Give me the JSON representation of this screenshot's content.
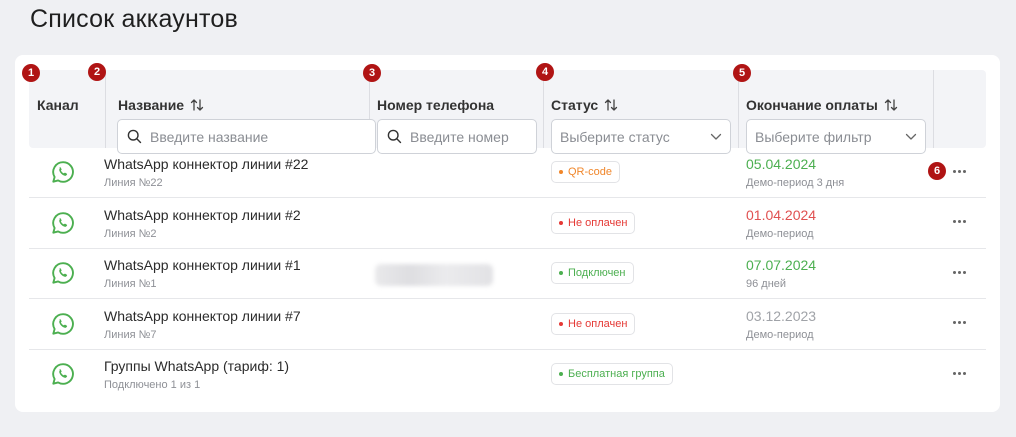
{
  "page_title": "Список аккаунтов",
  "columns": {
    "channel": "Канал",
    "name": "Название",
    "phone": "Номер телефона",
    "status": "Статус",
    "payment_end": "Окончание оплаты"
  },
  "filters": {
    "name_placeholder": "Введите название",
    "phone_placeholder": "Введите номер",
    "status_placeholder": "Выберите статус",
    "payment_placeholder": "Выберите фильтр"
  },
  "markers": [
    "1",
    "2",
    "3",
    "4",
    "5",
    "6"
  ],
  "colors": {
    "whatsapp": "#4caf50",
    "status_orange": "#f0862a",
    "status_red": "#e53935",
    "status_green": "#4caf50",
    "date_green": "#4caf50",
    "date_red": "#e05050",
    "date_grey": "#a0a3a8",
    "marker": "#b01414"
  },
  "rows": [
    {
      "name": "WhatsApp коннектор линии #22",
      "sub": "Линия №22",
      "phone_hidden": false,
      "status": "QR-code",
      "status_color": "#f0862a",
      "date": "05.04.2024",
      "date_color": "#4caf50",
      "date_sub": "Демо-период 3 дня",
      "channel_icon": "whatsapp-icon"
    },
    {
      "name": "WhatsApp коннектор линии #2",
      "sub": "Линия №2",
      "phone_hidden": false,
      "status": "Не оплачен",
      "status_color": "#e53935",
      "date": "01.04.2024",
      "date_color": "#e05050",
      "date_sub": "Демо-период",
      "channel_icon": "whatsapp-icon"
    },
    {
      "name": "WhatsApp коннектор линии #1",
      "sub": "Линия №1",
      "phone_hidden": true,
      "status": "Подключен",
      "status_color": "#4caf50",
      "date": "07.07.2024",
      "date_color": "#4caf50",
      "date_sub": "96 дней",
      "channel_icon": "whatsapp-icon"
    },
    {
      "name": "WhatsApp коннектор линии #7",
      "sub": "Линия №7",
      "phone_hidden": false,
      "status": "Не оплачен",
      "status_color": "#e53935",
      "date": "03.12.2023",
      "date_color": "#a0a3a8",
      "date_sub": "Демо-период",
      "channel_icon": "whatsapp-icon"
    },
    {
      "name": "Группы WhatsApp (тариф: 1)",
      "sub": "Подключено 1 из 1",
      "phone_hidden": false,
      "status": "Бесплатная группа",
      "status_color": "#4caf50",
      "date": "",
      "date_color": "#4caf50",
      "date_sub": "",
      "channel_icon": "whatsapp-icon"
    }
  ]
}
